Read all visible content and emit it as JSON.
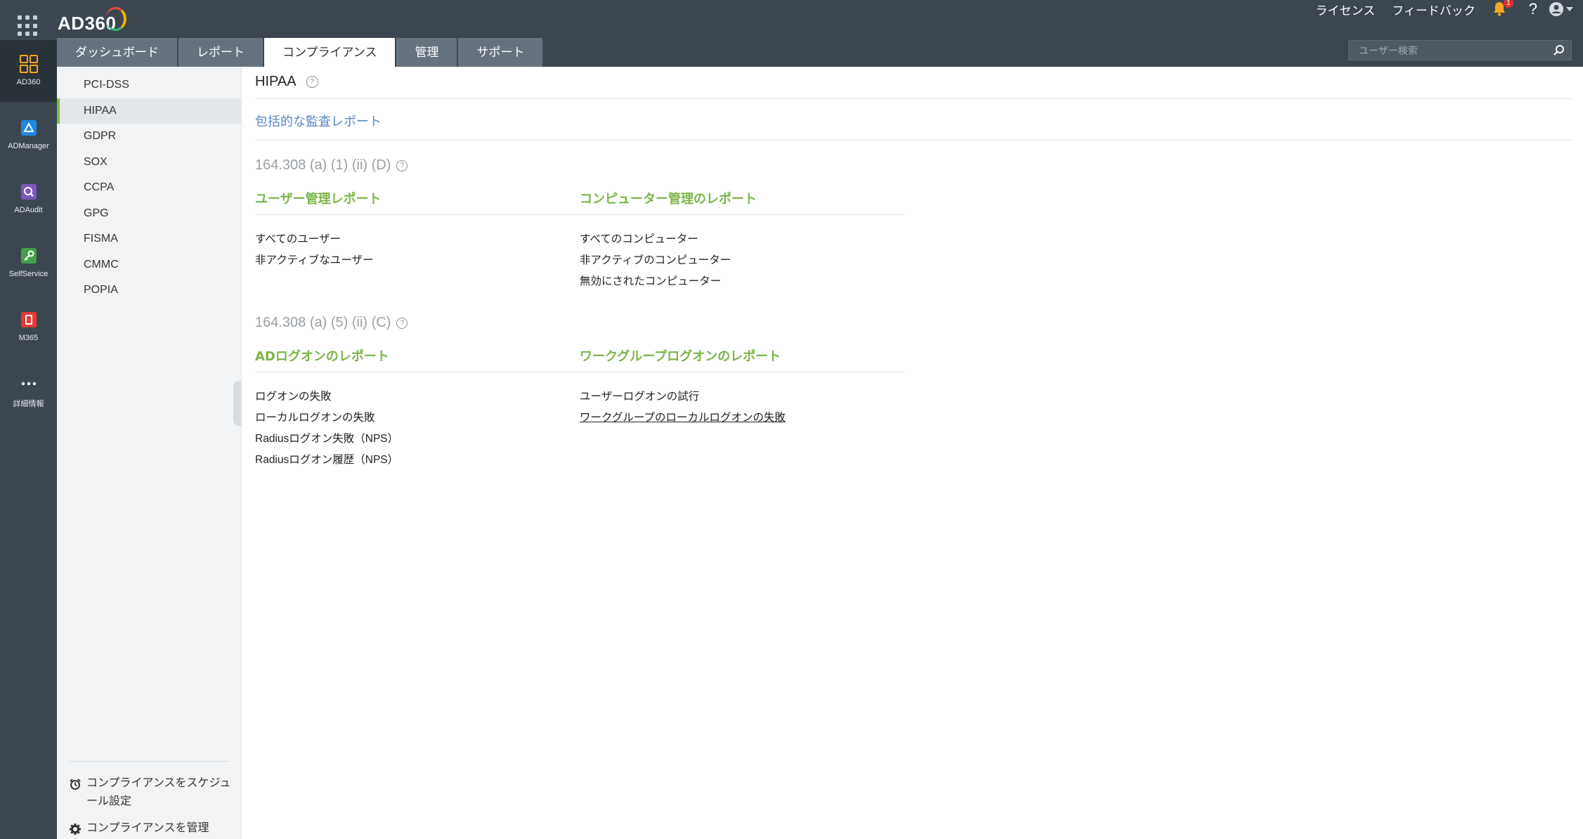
{
  "app": {
    "logo": "AD360"
  },
  "rail": {
    "items": [
      {
        "label": "AD360",
        "icon": "dashboard-grid-icon",
        "color": "#f5a623"
      },
      {
        "label": "ADManager",
        "icon": "admanager-icon",
        "color": "#1e88e5"
      },
      {
        "label": "ADAudit",
        "icon": "adaudit-icon",
        "color": "#7e57c2"
      },
      {
        "label": "SelfService",
        "icon": "key-icon",
        "color": "#43a047"
      },
      {
        "label": "M365",
        "icon": "office-icon",
        "color": "#e53935"
      },
      {
        "label": "詳細情報",
        "icon": "more-icon",
        "color": "#ffffff"
      }
    ]
  },
  "header": {
    "links": {
      "license": "ライセンス",
      "feedback": "フィードバック"
    },
    "notifications": "1",
    "help": "?",
    "tabs": [
      "ダッシュボード",
      "レポート",
      "コンプライアンス",
      "管理",
      "サポート"
    ],
    "active_tab": "コンプライアンス",
    "search": {
      "placeholder": "ユーザー検索"
    }
  },
  "sidebar": {
    "items": [
      {
        "label": "PCI-DSS"
      },
      {
        "label": "HIPAA"
      },
      {
        "label": "GDPR"
      },
      {
        "label": "SOX"
      },
      {
        "label": "CCPA"
      },
      {
        "label": "GPG"
      },
      {
        "label": "FISMA"
      },
      {
        "label": "CMMC"
      },
      {
        "label": "POPIA"
      }
    ],
    "active": "HIPAA",
    "footer": {
      "schedule": "コンプライアンスをスケジュール設定",
      "manage": "コンプライアンスを管理"
    }
  },
  "main": {
    "title": "HIPAA",
    "comprehensive_link": "包括的な監査レポート",
    "sections": [
      {
        "id": "164.308 (a) (1) (ii) (D)",
        "columns": [
          {
            "heading": "ユーザー管理レポート",
            "links": [
              "すべてのユーザー",
              "非アクティブなユーザー"
            ]
          },
          {
            "heading": "コンピューター管理のレポート",
            "links": [
              "すべてのコンピューター",
              "非アクティブのコンピューター",
              "無効にされたコンピューター"
            ]
          }
        ]
      },
      {
        "id": "164.308 (a) (5) (ii) (C)",
        "columns": [
          {
            "heading": "ADログオンのレポート",
            "links": [
              "ログオンの失敗",
              "ローカルログオンの失敗",
              "Radiusログオン失敗（NPS）",
              "Radiusログオン履歴（NPS）"
            ]
          },
          {
            "heading": "ワークグループログオンのレポート",
            "links": [
              "ユーザーログオンの試行",
              "ワークグループのローカルログオンの失敗"
            ]
          }
        ]
      }
    ]
  }
}
